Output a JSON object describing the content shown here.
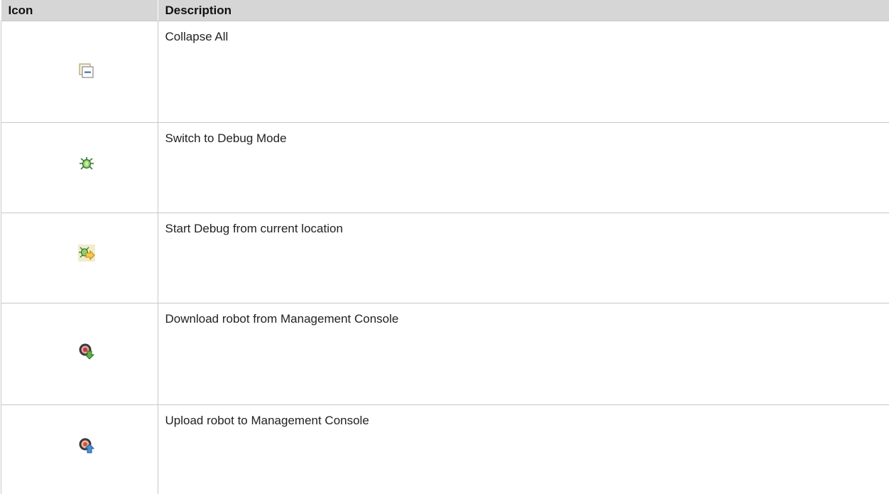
{
  "table": {
    "headers": {
      "icon": "Icon",
      "description": "Description"
    },
    "rows": [
      {
        "icon": "collapse-all-icon",
        "description": "Collapse All"
      },
      {
        "icon": "debug-bug-icon",
        "description": "Switch to Debug Mode"
      },
      {
        "icon": "debug-from-location-icon",
        "description": "Start Debug from current location"
      },
      {
        "icon": "download-robot-icon",
        "description": "Download robot from Management Console"
      },
      {
        "icon": "upload-robot-icon",
        "description": "Upload robot to Management Console"
      }
    ]
  },
  "colors": {
    "header_background": "#d6d6d6",
    "border": "#c8c8c8"
  }
}
